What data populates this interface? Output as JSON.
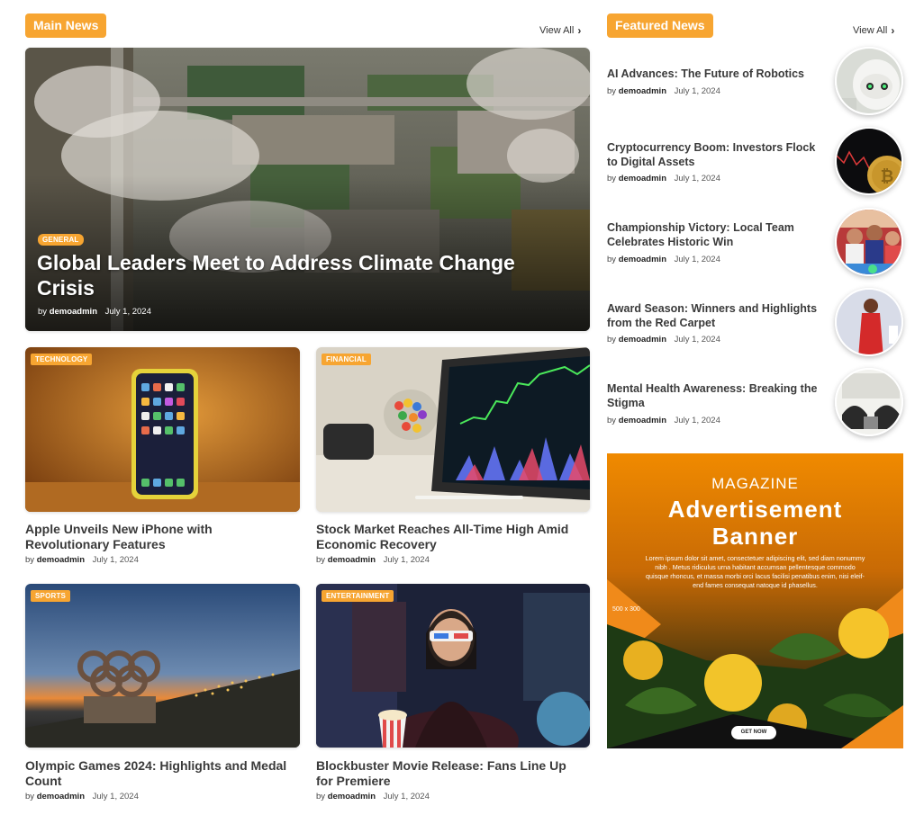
{
  "main_news": {
    "tag": "Main News",
    "view_all": "View All",
    "hero": {
      "category": "GENERAL",
      "title": "Global Leaders Meet to Address Climate Change Crisis",
      "by": "by",
      "author": "demoadmin",
      "date": "July 1, 2024"
    },
    "cards": [
      {
        "category": "TECHNOLOGY",
        "title": "Apple Unveils New iPhone with Revolutionary Features",
        "by": "by",
        "author": "demoadmin",
        "date": "July 1, 2024"
      },
      {
        "category": "FINANCIAL",
        "title": "Stock Market Reaches All-Time High Amid Economic Recovery",
        "by": "by",
        "author": "demoadmin",
        "date": "July 1, 2024"
      },
      {
        "category": "SPORTS",
        "title": "Olympic Games 2024: Highlights and Medal Count",
        "by": "by",
        "author": "demoadmin",
        "date": "July 1, 2024"
      },
      {
        "category": "ENTERTAINMENT",
        "title": "Blockbuster Movie Release: Fans Line Up for Premiere",
        "by": "by",
        "author": "demoadmin",
        "date": "July 1, 2024"
      }
    ]
  },
  "featured_news": {
    "tag": "Featured News",
    "view_all": "View All",
    "items": [
      {
        "title": "AI Advances: The Future of Robotics",
        "by": "by",
        "author": "demoadmin",
        "date": "July 1, 2024"
      },
      {
        "title": "Cryptocurrency Boom: Investors Flock to Digital Assets",
        "by": "by",
        "author": "demoadmin",
        "date": "July 1, 2024"
      },
      {
        "title": "Championship Victory: Local Team Celebrates Historic Win",
        "by": "by",
        "author": "demoadmin",
        "date": "July 1, 2024"
      },
      {
        "title": "Award Season: Winners and Highlights from the Red Carpet",
        "by": "by",
        "author": "demoadmin",
        "date": "July 1, 2024"
      },
      {
        "title": "Mental Health Awareness: Breaking the Stigma",
        "by": "by",
        "author": "demoadmin",
        "date": "July 1, 2024"
      }
    ]
  },
  "ad": {
    "kicker": "MAGAZINE",
    "headline_1": "Advertisement",
    "headline_2": "Banner",
    "body": "Lorem ipsum dolor sit amet, consectetuer adipiscing elit, sed diam nonummy nibh . Metus ridiculus urna habitant accumsan pellentesque commodo quisque rhoncus, et massa morbi orci lacus facilisi penatibus enim, nisi eleif-end fames consequat natoque id phasellus.",
    "size": "500 x 300",
    "cta": "GET NOW"
  },
  "colors": {
    "accent": "#f7a531"
  }
}
